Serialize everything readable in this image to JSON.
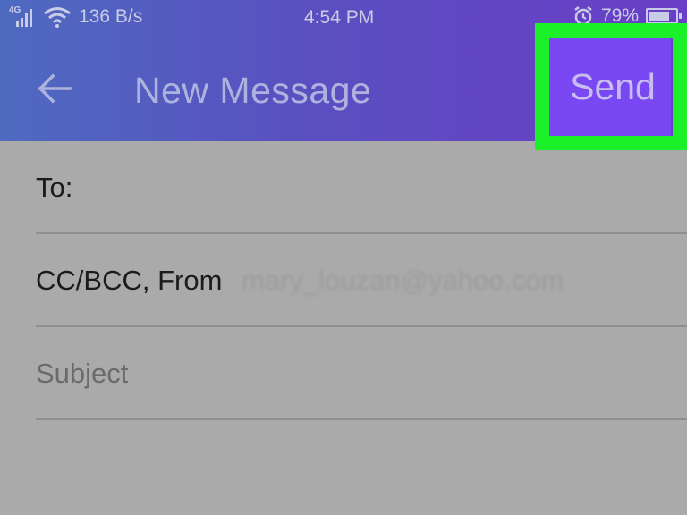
{
  "status_bar": {
    "network_tag": "4G",
    "data_rate": "136 B/s",
    "time": "4:54 PM",
    "battery": "79%",
    "battery_level": 0.79,
    "icons": [
      "signal-icon",
      "wifi-icon",
      "alarm-icon",
      "battery-icon"
    ]
  },
  "app_bar": {
    "title": "New Message",
    "back_icon": "arrow-left-icon",
    "send_label": "Send",
    "send_color": "#7a48f2",
    "highlight_color": "#1cf028"
  },
  "form": {
    "to_label": "To:",
    "cc_label": "CC/BCC, From",
    "from_value": "mary_louzan@yahoo.com",
    "subject_placeholder": "Subject"
  }
}
